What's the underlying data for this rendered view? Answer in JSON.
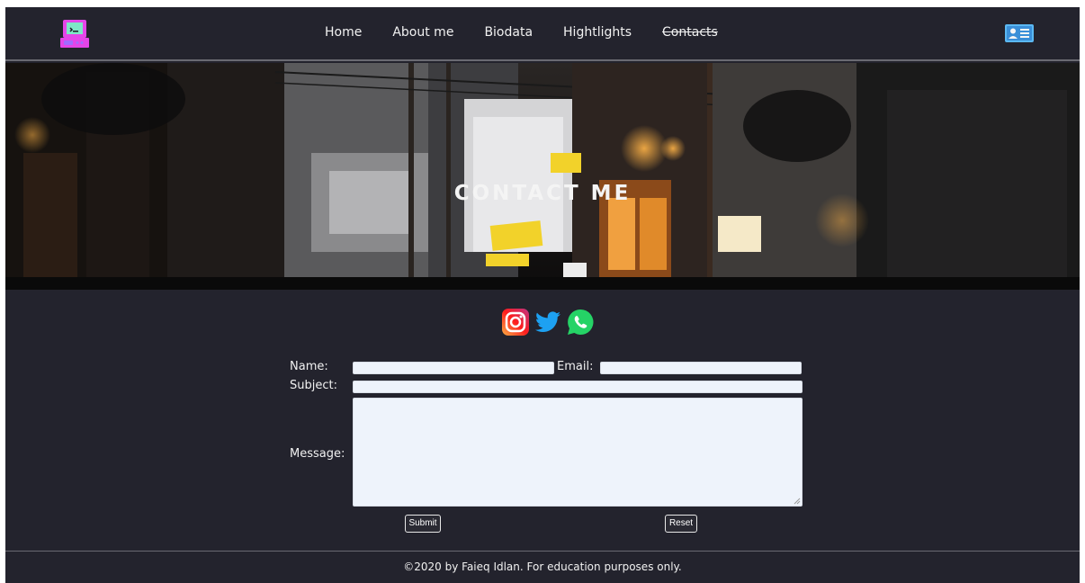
{
  "nav": {
    "logo_icon": "retro-computer-icon",
    "items": [
      {
        "label": "Home"
      },
      {
        "label": "About me"
      },
      {
        "label": "Biodata"
      },
      {
        "label": "Hightlights"
      },
      {
        "label": "Contacts"
      }
    ],
    "right_icon": "id-card-icon"
  },
  "hero": {
    "title": "CONTACT  ME"
  },
  "social": [
    "instagram-icon",
    "twitter-icon",
    "whatsapp-icon"
  ],
  "form": {
    "name_label": "Name:",
    "email_label": "Email:",
    "subject_label": "Subject:",
    "message_label": "Message:",
    "name_value": "",
    "email_value": "",
    "subject_value": "",
    "message_value": "",
    "submit_label": "Submit",
    "reset_label": "Reset"
  },
  "footer": {
    "text": "©2020 by Faieq Idlan. For education purposes only."
  },
  "colors": {
    "background": "#23232d",
    "field": "#eef3fb",
    "accent_pink": "#e545e8",
    "accent_green": "#7ee8c7"
  }
}
